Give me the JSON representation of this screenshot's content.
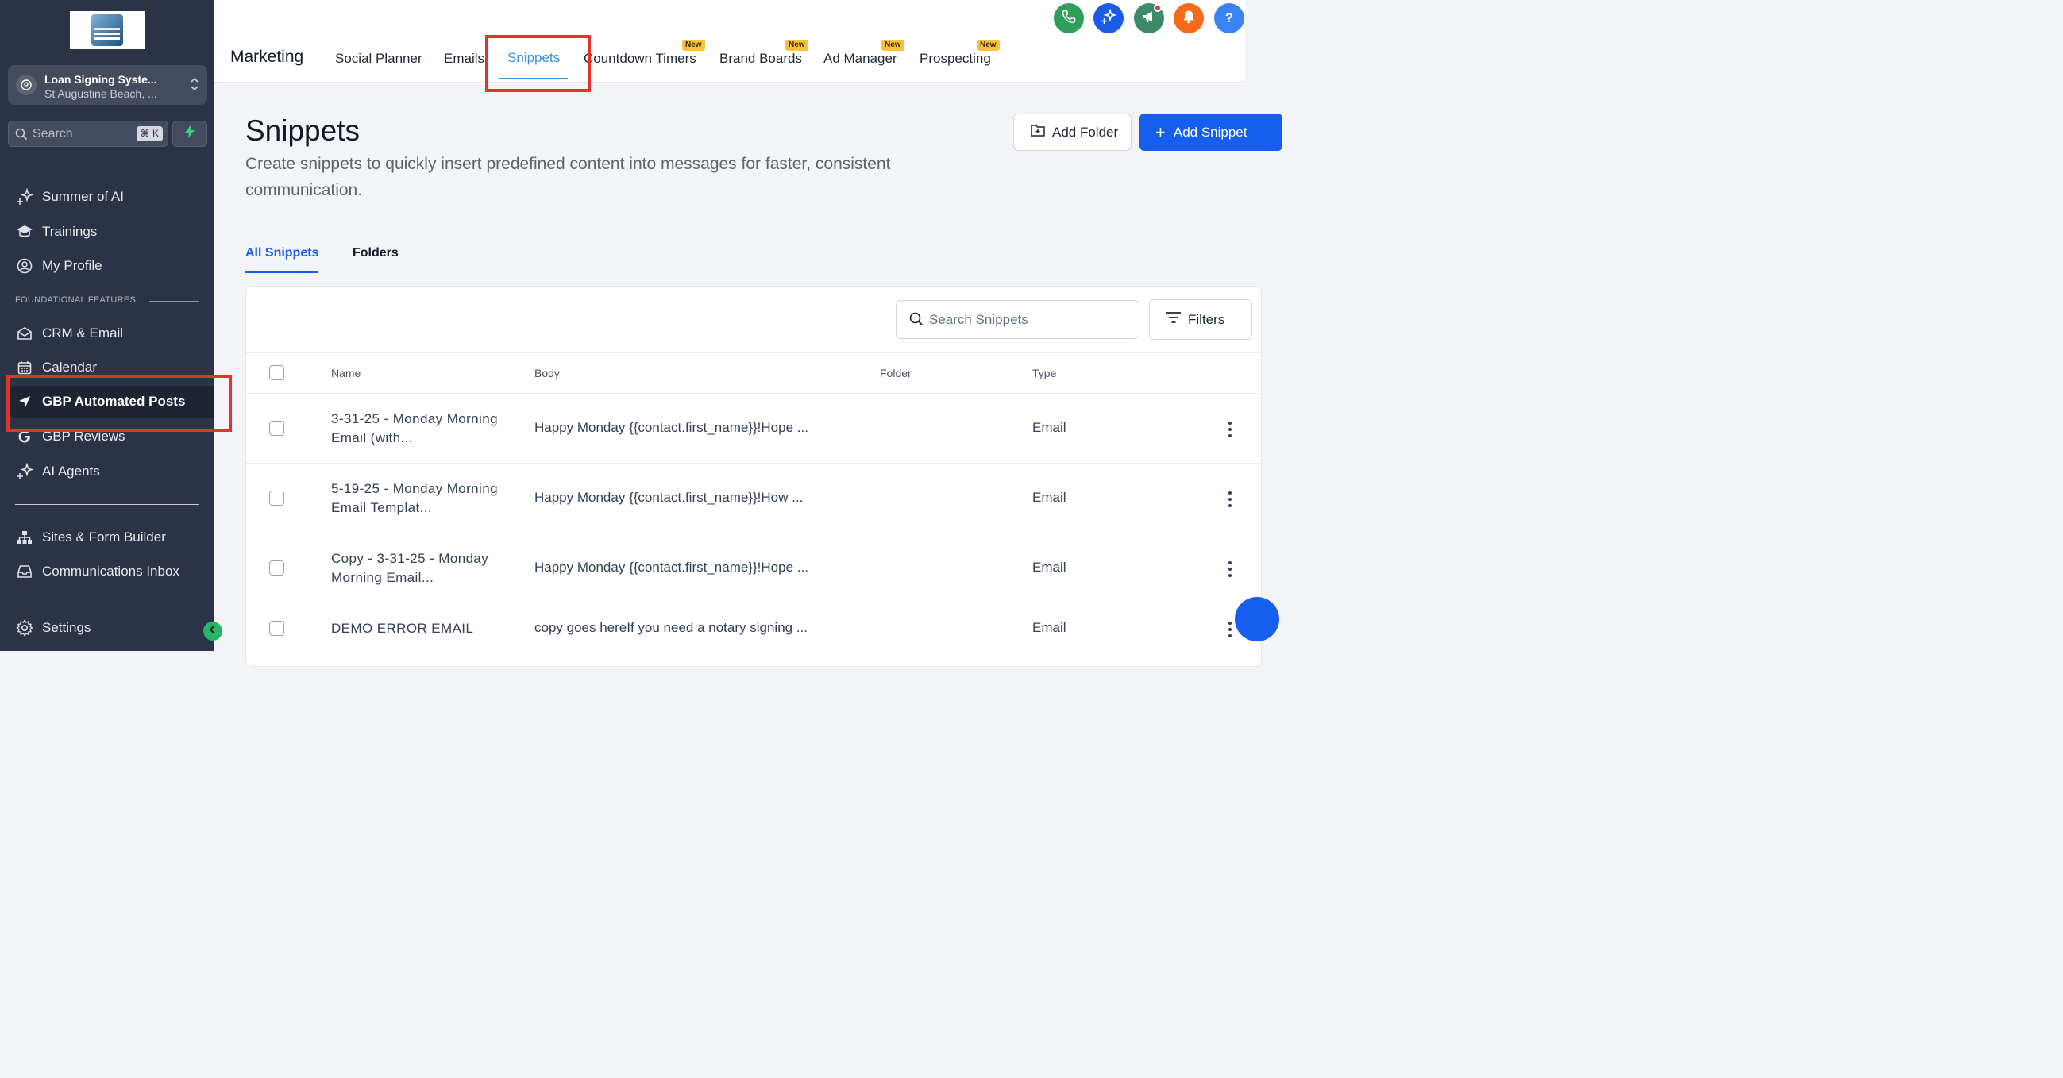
{
  "sidebar": {
    "location": {
      "name": "Loan Signing Syste...",
      "address": "St Augustine Beach, ..."
    },
    "search": {
      "placeholder": "Search",
      "shortcut": "⌘ K"
    },
    "items_top": [
      {
        "label": "Summer of AI",
        "icon": "sparkle-icon"
      },
      {
        "label": "Trainings",
        "icon": "graduation-cap-icon"
      },
      {
        "label": "My Profile",
        "icon": "user-circle-icon"
      }
    ],
    "section_label": "FOUNDATIONAL FEATURES",
    "items_foundational": [
      {
        "label": "CRM & Email",
        "icon": "envelope-icon"
      },
      {
        "label": "Calendar",
        "icon": "calendar-icon"
      },
      {
        "label": "GBP Automated Posts",
        "icon": "navigation-arrow-icon",
        "active": true
      },
      {
        "label": "GBP Reviews",
        "icon": "google-g-icon"
      },
      {
        "label": "AI Agents",
        "icon": "sparkle-icon"
      }
    ],
    "items_bottom": [
      {
        "label": "Sites & Form Builder",
        "icon": "sitemap-icon"
      },
      {
        "label": "Communications Inbox",
        "icon": "inbox-icon"
      }
    ],
    "settings_label": "Settings"
  },
  "topbar": {
    "brand": "Marketing",
    "tabs": [
      {
        "label": "Social Planner"
      },
      {
        "label": "Emails"
      },
      {
        "label": "Snippets",
        "active": true
      },
      {
        "label": "Countdown Timers",
        "badge": "New"
      },
      {
        "label": "Brand Boards",
        "badge": "New"
      },
      {
        "label": "Ad Manager",
        "badge": "New"
      },
      {
        "label": "Prospecting",
        "badge": "New"
      }
    ],
    "icons": [
      "phone-icon",
      "ai-sparkle-icon",
      "megaphone-icon",
      "bell-icon",
      "help-icon"
    ],
    "help_glyph": "?",
    "colors": {
      "phone": "#2e9e58",
      "ai": "#1c5be8",
      "megaphone": "#3d8a6a",
      "bell": "#f46a1c",
      "help": "#3b82f6"
    }
  },
  "page": {
    "title": "Snippets",
    "description": "Create snippets to quickly insert predefined content into messages for faster, consistent communication.",
    "add_folder_label": "Add Folder",
    "add_snippet_label": "Add Snippet",
    "subtabs": [
      {
        "label": "All Snippets",
        "active": true
      },
      {
        "label": "Folders"
      }
    ],
    "search_placeholder": "Search Snippets",
    "filters_label": "Filters",
    "table": {
      "columns": [
        "Name",
        "Body",
        "Folder",
        "Type"
      ],
      "rows": [
        {
          "name": "3-31-25 - Monday Morning Email (with...",
          "body": "Happy Monday {{contact.first_name}}!Hope ...",
          "folder": "",
          "type": "Email"
        },
        {
          "name": "5-19-25 - Monday Morning Email Templat...",
          "body": "Happy Monday {{contact.first_name}}!How ...",
          "folder": "",
          "type": "Email"
        },
        {
          "name": "Copy - 3-31-25 - Monday Morning Email...",
          "body": "Happy Monday {{contact.first_name}}!Hope ...",
          "folder": "",
          "type": "Email"
        },
        {
          "name": "DEMO ERROR EMAIL",
          "body": "copy goes hereIf you need a notary signing ...",
          "folder": "",
          "type": "Email"
        }
      ]
    }
  },
  "accent_color": "#155eef",
  "highlight_color": "#e53327"
}
